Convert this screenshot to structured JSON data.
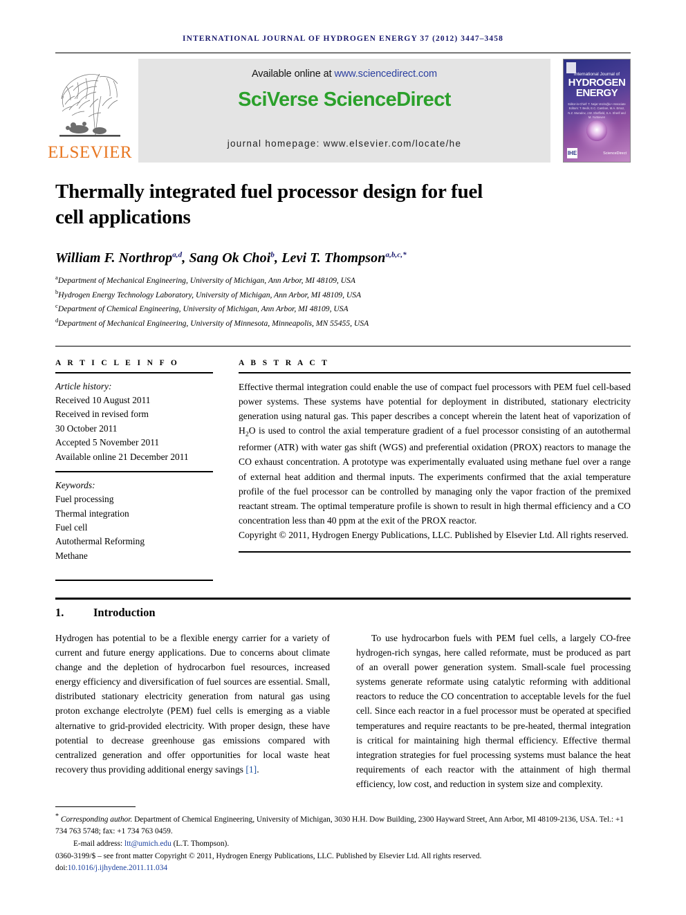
{
  "running_head": "International Journal of Hydrogen Energy 37 (2012) 3447–3458",
  "masthead": {
    "publisher_name": "ELSEVIER",
    "tree_logo_name": "elsevier-tree-logo",
    "available_prefix": "Available online at ",
    "available_url": "www.sciencedirect.com",
    "brand": "SciVerse ScienceDirect",
    "homepage": "journal homepage: www.elsevier.com/locate/he",
    "cover": {
      "line_small": "International Journal of",
      "line_big_1": "HYDROGEN",
      "line_big_2": "ENERGY",
      "editors": "Editor-in-Chief: T. Nejat Veziroğlu   •   Associate Editors: T. Bedir, E.C. Cambon, M.A. Ersoz, N.Z. Muradov, J.W. Sheffield, S.A. Sherif and M. Yurtseven",
      "logo_left": "IHE",
      "logo_right": "ScienceDirect"
    }
  },
  "article": {
    "title_line_1": "Thermally integrated fuel processor design for fuel",
    "title_line_2": "cell applications",
    "authors": [
      {
        "name": "William F. Northrop",
        "sup": "a,d",
        "sep": ", "
      },
      {
        "name": "Sang Ok Choi",
        "sup": "b",
        "sep": ", "
      },
      {
        "name": "Levi T. Thompson",
        "sup": "a,b,c,*",
        "sep": ""
      }
    ],
    "affiliations": [
      {
        "marker": "a",
        "text": "Department of Mechanical Engineering, University of Michigan, Ann Arbor, MI 48109, USA"
      },
      {
        "marker": "b",
        "text": "Hydrogen Energy Technology Laboratory, University of Michigan, Ann Arbor, MI 48109, USA"
      },
      {
        "marker": "c",
        "text": "Department of Chemical Engineering, University of Michigan, Ann Arbor, MI 48109, USA"
      },
      {
        "marker": "d",
        "text": "Department of Mechanical Engineering, University of Minnesota, Minneapolis, MN 55455, USA"
      }
    ]
  },
  "article_info": {
    "heading": "A R T I C L E   I N F O",
    "history_label": "Article history:",
    "history": [
      "Received 10 August 2011",
      "Received in revised form",
      "30 October 2011",
      "Accepted 5 November 2011",
      "Available online 21 December 2011"
    ],
    "keywords_label": "Keywords:",
    "keywords": [
      "Fuel processing",
      "Thermal integration",
      "Fuel cell",
      "Autothermal Reforming",
      "Methane"
    ]
  },
  "abstract": {
    "heading": "A B S T R A C T",
    "text_part_1": "Effective thermal integration could enable the use of compact fuel processors with PEM fuel cell-based power systems. These systems have potential for deployment in distributed, stationary electricity generation using natural gas. This paper describes a concept wherein the latent heat of vaporization of H",
    "h2o_sub": "2",
    "text_part_2": "O is used to control the axial temperature gradient of a fuel processor consisting of an autothermal reformer (ATR) with water gas shift (WGS) and preferential oxidation (PROX) reactors to manage the CO exhaust concentration. A prototype was experimentally evaluated using methane fuel over a range of external heat addition and thermal inputs. The experiments confirmed that the axial temperature profile of the fuel processor can be controlled by managing only the vapor fraction of the premixed reactant stream. The optimal temperature profile is shown to result in high thermal efficiency and a CO concentration less than 40 ppm at the exit of the PROX reactor.",
    "copyright": "Copyright © 2011, Hydrogen Energy Publications, LLC. Published by Elsevier Ltd. All rights reserved."
  },
  "introduction": {
    "number": "1.",
    "title": "Introduction",
    "paragraph_left": "Hydrogen has potential to be a flexible energy carrier for a variety of current and future energy applications. Due to concerns about climate change and the depletion of hydrocarbon fuel resources, increased energy efficiency and diversification of fuel sources are essential. Small, distributed stationary electricity generation from natural gas using proton exchange electrolyte (PEM) fuel cells is emerging as a viable alternative to grid-provided electricity. With proper design, these have potential to decrease greenhouse gas emissions compared with centralized generation and offer opportunities for local waste heat recovery thus providing additional energy savings ",
    "paragraph_left_ref": "[1]",
    "paragraph_left_end": ".",
    "paragraph_right": "To use hydrocarbon fuels with PEM fuel cells, a largely CO-free hydrogen-rich syngas, here called reformate, must be produced as part of an overall power generation system. Small-scale fuel processing systems generate reformate using catalytic reforming with additional reactors to reduce the CO concentration to acceptable levels for the fuel cell. Since each reactor in a fuel processor must be operated at specified temperatures and require reactants to be pre-heated, thermal integration is critical for maintaining high thermal efficiency. Effective thermal integration strategies for fuel processing systems must balance the heat requirements of each reactor with the attainment of high thermal efficiency, low cost, and reduction in system size and complexity."
  },
  "footnotes": {
    "corresponding_star": "*",
    "corresponding_label": "Corresponding author.",
    "corresponding_text": " Department of Chemical Engineering, University of Michigan, 3030 H.H. Dow Building, 2300 Hayward Street, Ann Arbor, MI 48109-2136, USA. Tel.: +1 734 763 5748; fax: +1 734 763 0459.",
    "email_label": "E-mail address: ",
    "email": "ltt@umich.edu",
    "email_suffix": " (L.T. Thompson).",
    "issn_line": "0360-3199/$ – see front matter Copyright © 2011, Hydrogen Energy Publications, LLC. Published by Elsevier Ltd. All rights reserved.",
    "doi_label": "doi:",
    "doi": "10.1016/j.ijhydene.2011.11.034"
  },
  "colors": {
    "running_head_blue": "#1a1a6e",
    "elsevier_orange": "#E87722",
    "sciencedirect_green": "#2ba02b",
    "link_blue": "#2b3fa0",
    "banner_grey": "#e4e4e4"
  }
}
